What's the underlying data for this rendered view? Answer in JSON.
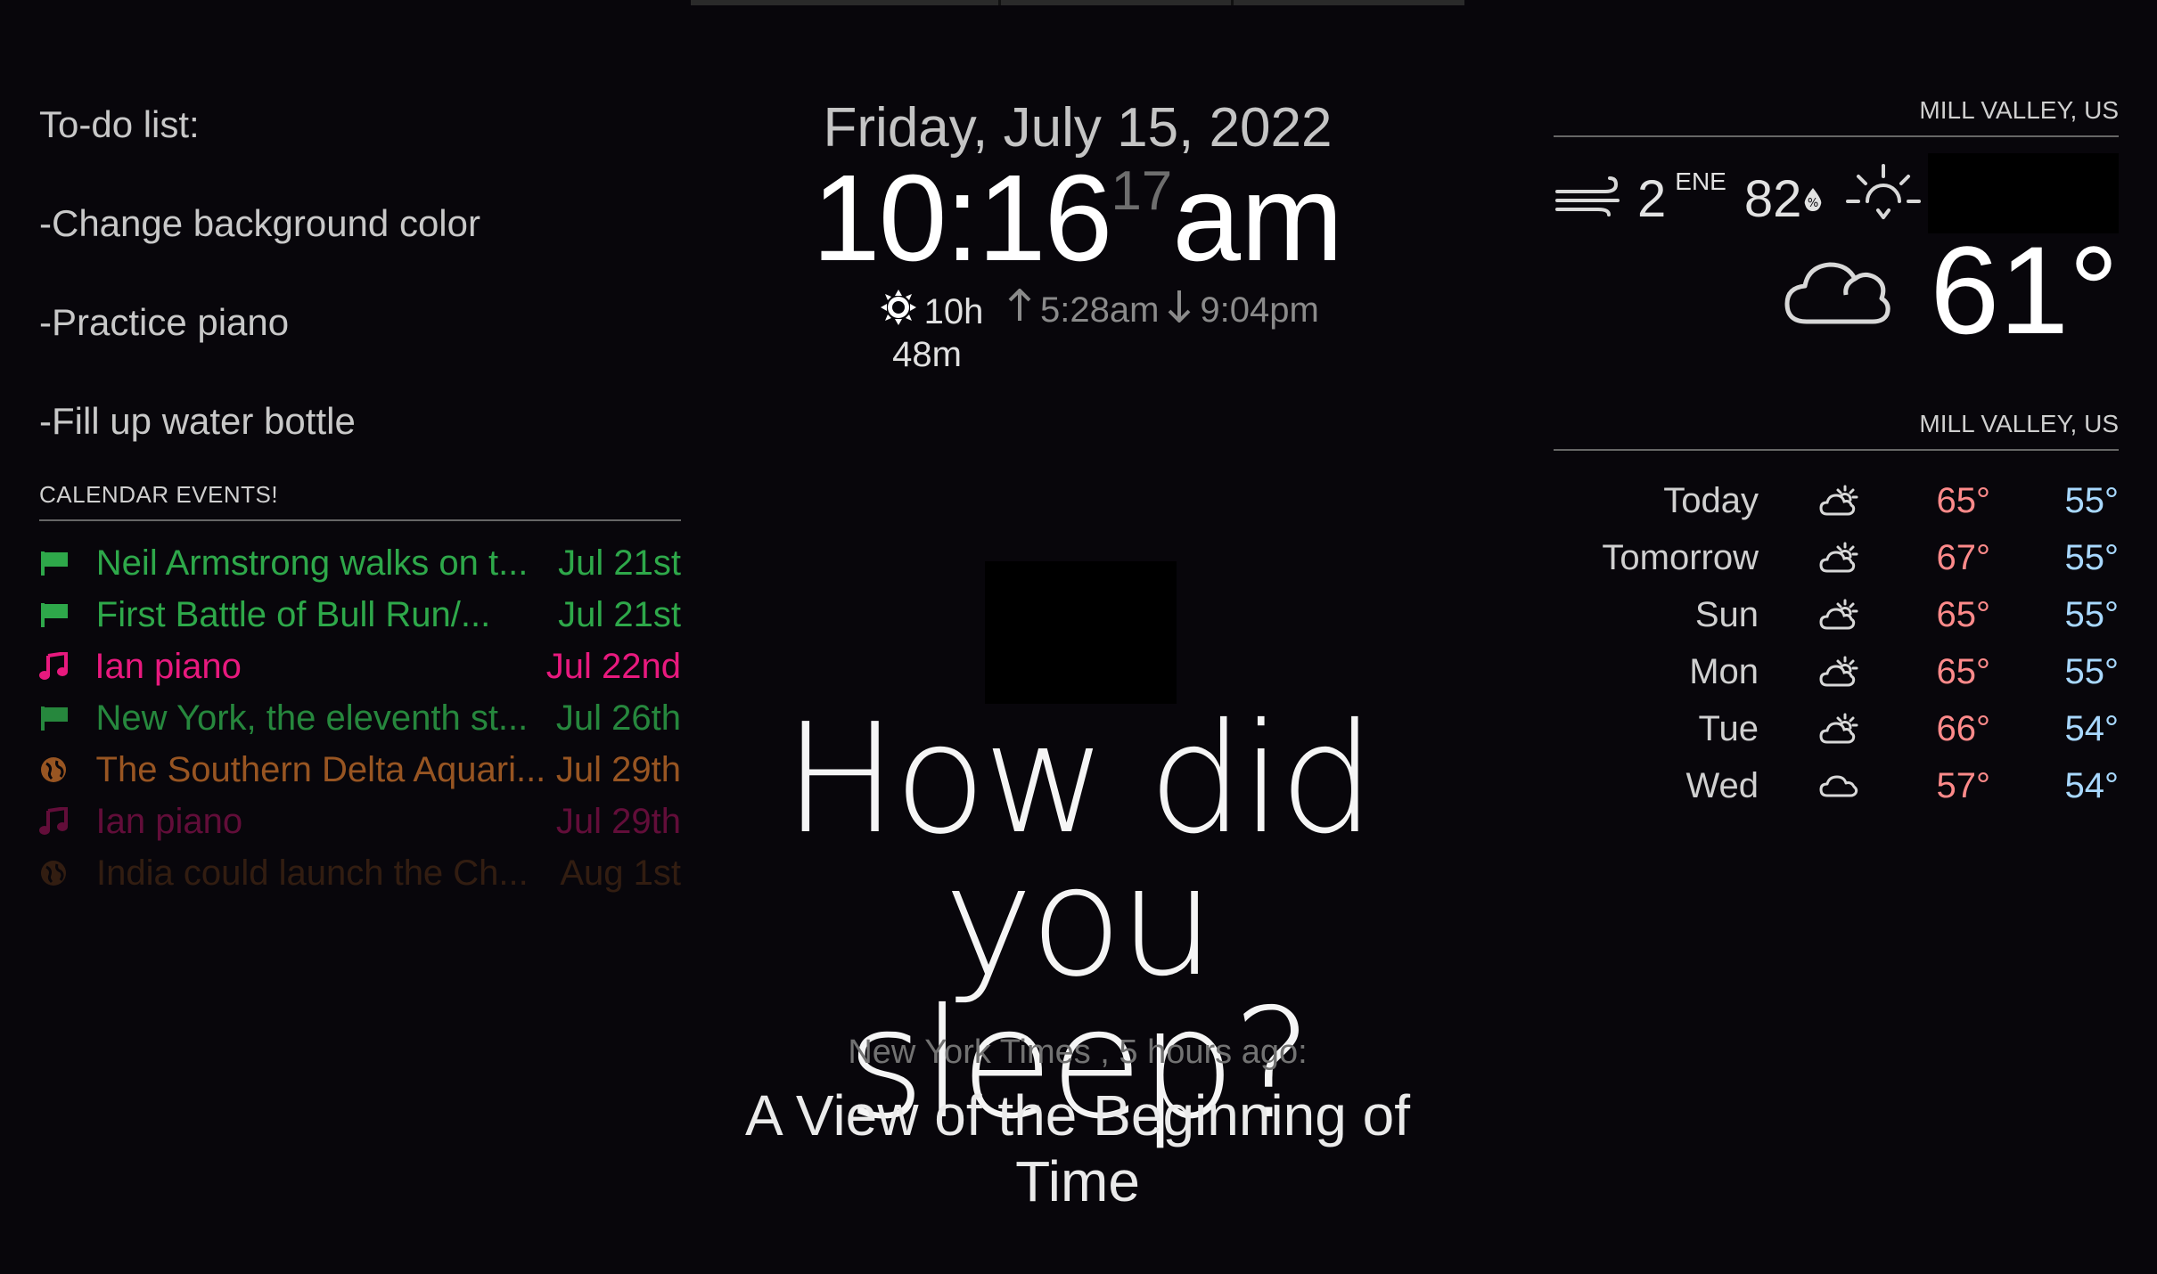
{
  "todo": {
    "lines": [
      "To-do list:",
      "-Change background color",
      "-Practice piano",
      "-Fill up water bottle"
    ]
  },
  "calendar": {
    "header": "CALENDAR EVENTS!",
    "events": [
      {
        "icon": "flag-icon",
        "title": "Neil Armstrong walks on t...",
        "date": "Jul 21st",
        "color": "#2ea84a",
        "opacity": 1
      },
      {
        "icon": "flag-icon",
        "title": "First Battle of Bull Run/...",
        "date": "Jul 21st",
        "color": "#2ea84a",
        "opacity": 1
      },
      {
        "icon": "music-icon",
        "title": "Ian piano",
        "date": "Jul 22nd",
        "color": "#e8197e",
        "opacity": 1
      },
      {
        "icon": "flag-icon",
        "title": "New York, the eleventh st...",
        "date": "Jul 26th",
        "color": "#2ea84a",
        "opacity": 0.8
      },
      {
        "icon": "globe-icon",
        "title": "The Southern Delta Aquari...",
        "date": "Jul 29th",
        "color": "#c8702a",
        "opacity": 0.75
      },
      {
        "icon": "music-icon",
        "title": "Ian piano",
        "date": "Jul 29th",
        "color": "#e8197e",
        "opacity": 0.4
      },
      {
        "icon": "globe-icon",
        "title": "India could launch the Ch...",
        "date": "Aug 1st",
        "color": "#c8702a",
        "opacity": 0.22
      }
    ]
  },
  "clock": {
    "date": "Friday, July 15, 2022",
    "time": "10:16",
    "seconds": "17",
    "ampm": "am",
    "daylight_hours": "10h",
    "daylight_minutes": "48m",
    "sunrise": "5:28am",
    "sunset": "9:04pm"
  },
  "compliment": {
    "line1": "How did you",
    "line2": "sleep?"
  },
  "news": {
    "source": "New York Times , 5 hours ago:",
    "title": "A View of the Beginning of Time"
  },
  "weather": {
    "location": "MILL VALLEY, US",
    "wind_speed": "2",
    "wind_dir": "ENE",
    "humidity": "82",
    "temperature": "61°"
  },
  "forecast": {
    "location": "MILL VALLEY, US",
    "days": [
      {
        "day": "Today",
        "icon": "partly-cloudy-icon",
        "high": "65°",
        "low": "55°"
      },
      {
        "day": "Tomorrow",
        "icon": "partly-cloudy-icon",
        "high": "67°",
        "low": "55°"
      },
      {
        "day": "Sun",
        "icon": "partly-cloudy-icon",
        "high": "65°",
        "low": "55°"
      },
      {
        "day": "Mon",
        "icon": "partly-cloudy-icon",
        "high": "65°",
        "low": "55°"
      },
      {
        "day": "Tue",
        "icon": "partly-cloudy-icon",
        "high": "66°",
        "low": "54°"
      },
      {
        "day": "Wed",
        "icon": "cloud-icon",
        "high": "57°",
        "low": "54°"
      }
    ],
    "high_color": "#ff8a8a",
    "low_color": "#a8d8ff"
  }
}
